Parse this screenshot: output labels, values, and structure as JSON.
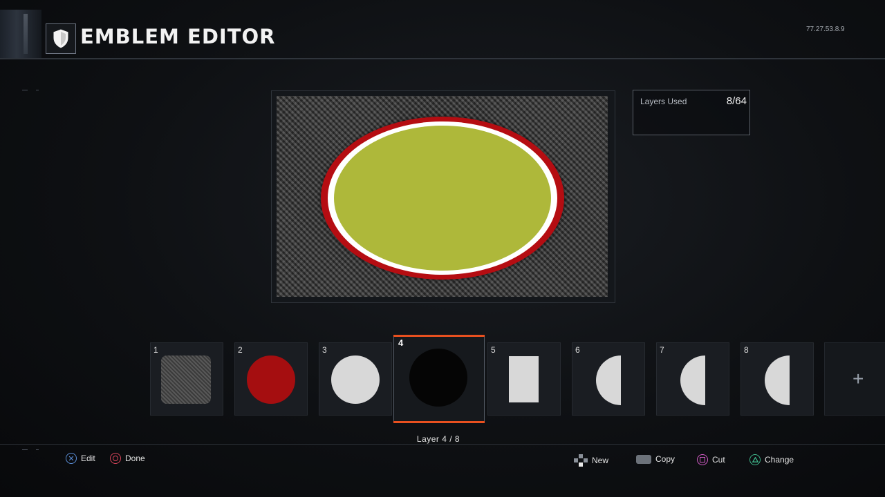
{
  "header": {
    "title": "EMBLEM EDITOR",
    "build": "77.27.53.8.9"
  },
  "layers_used": {
    "label": "Layers Used",
    "value": "8/64"
  },
  "layers": [
    {
      "num": "1",
      "shape": "rounded-square",
      "color": "#4a4a4a"
    },
    {
      "num": "2",
      "shape": "circle",
      "color": "#a50e10"
    },
    {
      "num": "3",
      "shape": "circle",
      "color": "#d8d8d8"
    },
    {
      "num": "4",
      "shape": "circle",
      "color": "#050505"
    },
    {
      "num": "5",
      "shape": "rectangle",
      "color": "#d8d8d8"
    },
    {
      "num": "6",
      "shape": "half-circle",
      "color": "#d8d8d8"
    },
    {
      "num": "7",
      "shape": "half-circle",
      "color": "#d8d8d8"
    },
    {
      "num": "8",
      "shape": "half-circle",
      "color": "#d8d8d8"
    }
  ],
  "selected_layer_caption": "Layer 4 / 8",
  "add_layer_symbol": "+",
  "canvas": {
    "background": "carbon-fiber",
    "ring_outer": "#b50d12",
    "ring_inner": "#ffffff",
    "fill": "#aeb83a"
  },
  "footer": {
    "left": [
      {
        "icon": "cross-button-icon",
        "label": "Edit",
        "color": "#5b8fd8"
      },
      {
        "icon": "circle-button-icon",
        "label": "Done",
        "color": "#d8455a"
      }
    ],
    "right": [
      {
        "icon": "dpad-icon",
        "label": "New"
      },
      {
        "icon": "touchpad-icon",
        "label": "Copy"
      },
      {
        "icon": "square-button-icon",
        "label": "Cut",
        "color": "#d25cc6"
      },
      {
        "icon": "triangle-button-icon",
        "label": "Change",
        "color": "#3fb58a"
      }
    ]
  }
}
